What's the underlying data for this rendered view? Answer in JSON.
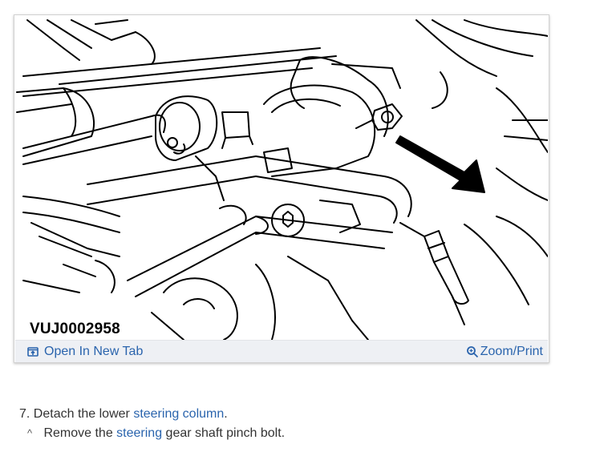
{
  "figure": {
    "image_id_label": "VUJ0002958",
    "open_tab_label": "Open In New Tab",
    "zoom_print_label": "Zoom/Print"
  },
  "steps": {
    "step7": {
      "number": "7.",
      "prefix": "Detach the lower",
      "link": "steering column",
      "suffix": "."
    },
    "sub1": {
      "caret": "^",
      "prefix": "Remove the",
      "link": "steering",
      "suffix": "gear shaft pinch bolt."
    }
  },
  "colors": {
    "link": "#2a64ad",
    "bar_bg": "#eef0f4"
  },
  "icons": [
    "open-in-new-tab-icon",
    "magnifier-zoom-icon"
  ]
}
